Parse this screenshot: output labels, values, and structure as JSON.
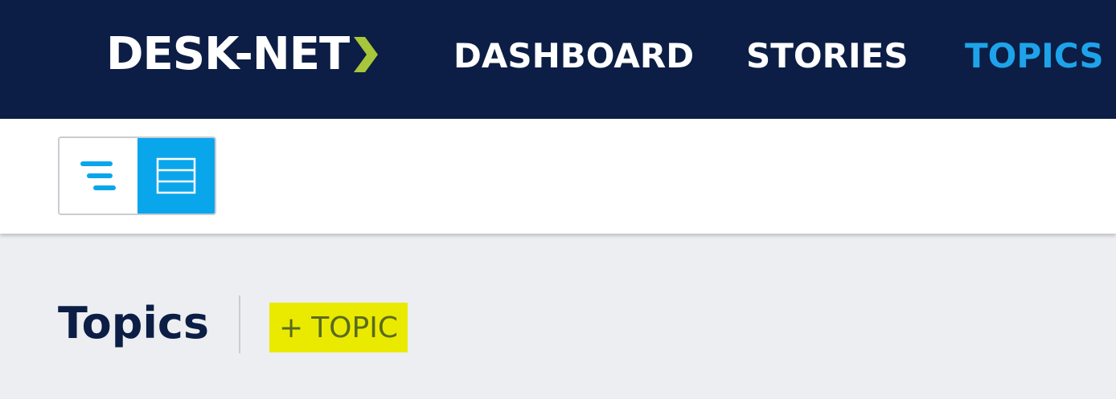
{
  "header": {
    "logo_text": "DESK-NET",
    "logo_accent_color": "#a7c63a",
    "background_color": "#0c1e45",
    "nav": [
      {
        "label": "DASHBOARD",
        "active": false
      },
      {
        "label": "STORIES",
        "active": false
      },
      {
        "label": "TOPICS",
        "active": true
      }
    ],
    "active_color": "#1ea3ea"
  },
  "toolbar": {
    "view_toggle": {
      "options": [
        {
          "icon": "list-view-icon",
          "selected": false
        },
        {
          "icon": "grid-view-icon",
          "selected": true
        }
      ],
      "selected_color": "#0aa6ec"
    }
  },
  "main": {
    "title": "Topics",
    "add_button": {
      "icon": "plus",
      "label": "TOPIC",
      "highlight_color": "#eaea00"
    }
  }
}
